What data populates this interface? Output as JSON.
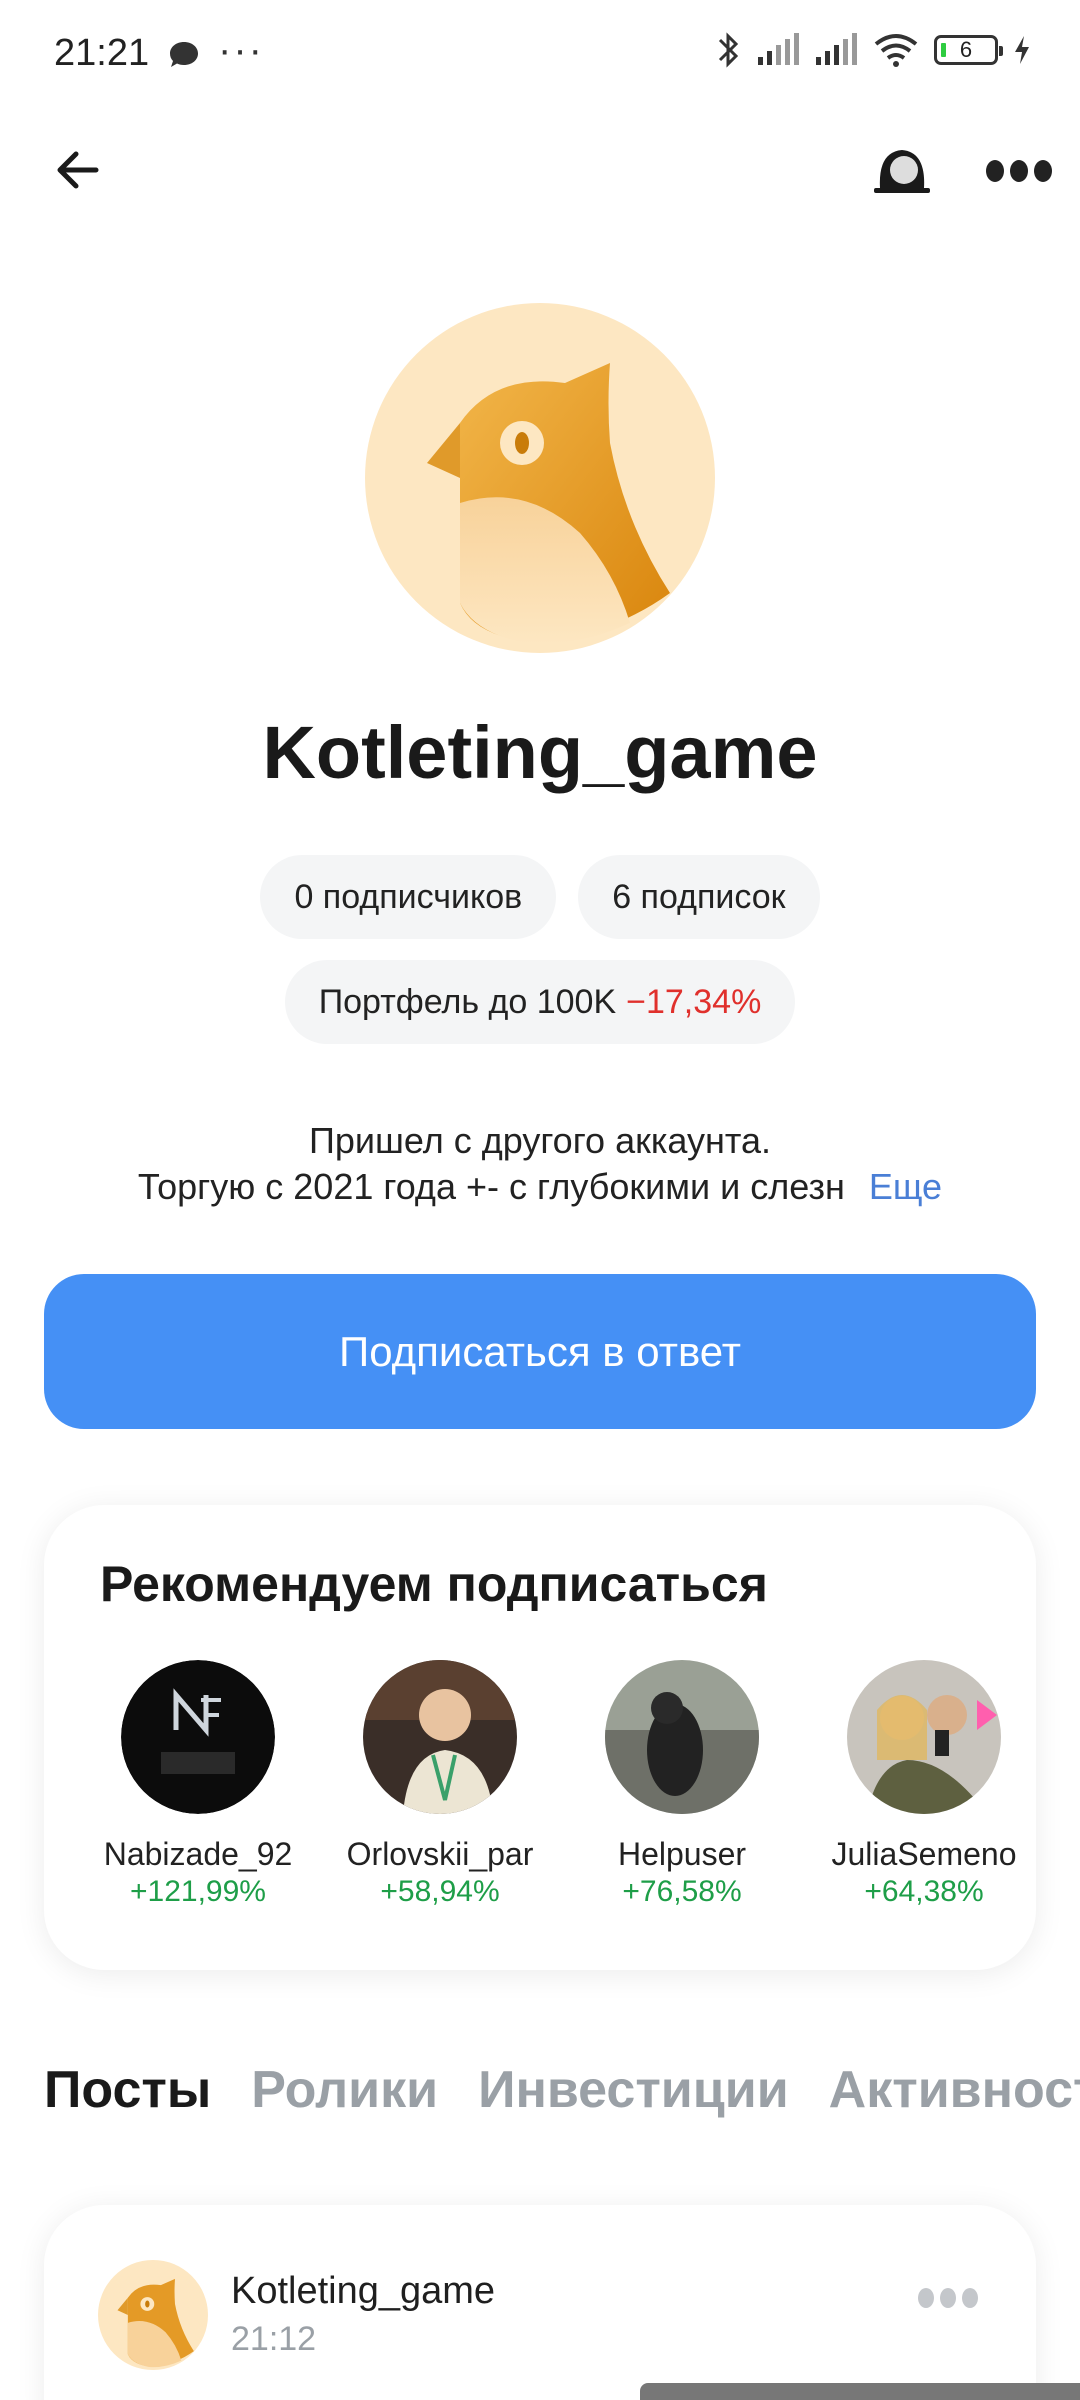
{
  "status_bar": {
    "time": "21:21",
    "battery": "6"
  },
  "profile": {
    "username": "Kotleting_game",
    "followers": "0 подписчиков",
    "following": "6 подписок",
    "portfolio_label": "Портфель до 100K",
    "portfolio_change": "−17,34%",
    "bio_line1": "Пришел с другого аккаунта.",
    "bio_line2": "Торгую с 2021 года +- с глубокими и слезн",
    "more_link": "Еще",
    "subscribe_button": "Подписаться в ответ"
  },
  "recommend": {
    "title": "Рекомендуем подписаться",
    "items": [
      {
        "name": "Nabizade_92",
        "pct": "+121,99%"
      },
      {
        "name": "Orlovskii_par",
        "pct": "+58,94%"
      },
      {
        "name": "Helpuser",
        "pct": "+76,58%"
      },
      {
        "name": "JuliaSemeno",
        "pct": "+64,38%"
      }
    ]
  },
  "tabs": [
    "Посты",
    "Ролики",
    "Инвестиции",
    "Активность"
  ],
  "post": {
    "author": "Kotleting_game",
    "time": "21:12"
  },
  "colors": {
    "accent": "#4590f5",
    "negative": "#e0302c",
    "positive": "#1e9e48"
  }
}
